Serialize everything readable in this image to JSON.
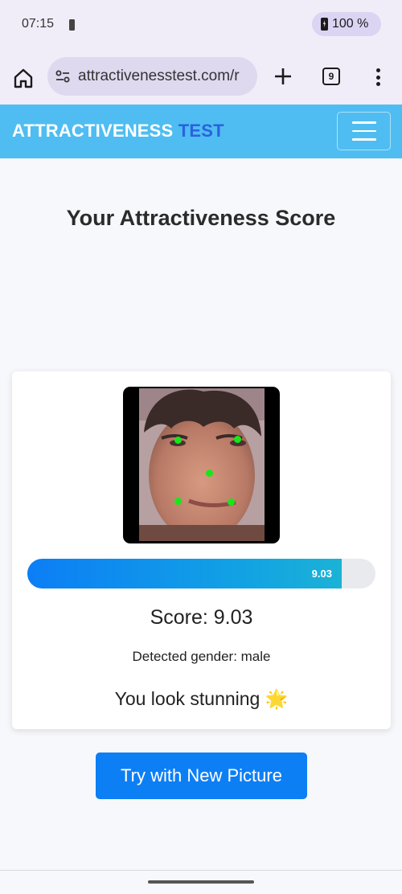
{
  "status_bar": {
    "time": "07:15",
    "battery": "100 %"
  },
  "browser": {
    "url": "attractivenesstest.com/r",
    "tab_count": "9"
  },
  "site": {
    "brand_part1": "ATTRACTIVENESS",
    "brand_part2": "TEST"
  },
  "main": {
    "title": "Your Attractiveness Score",
    "progress_value": 9.03,
    "progress_max": 10,
    "progress_label": "9.03",
    "score_text": "Score: 9.03",
    "gender_text": "Detected gender: male",
    "verdict_text": "You look stunning",
    "verdict_emoji": "🌟",
    "button_label": "Try with New Picture"
  },
  "colors": {
    "navbar": "#4fbdf1",
    "brand_accent": "#2a62e0",
    "button": "#0d7ff5",
    "landmark": "#19e619"
  },
  "icons": [
    "battery-icon",
    "home-icon",
    "site-info-icon",
    "plus-icon",
    "tab-switcher-icon",
    "more-vert-icon",
    "hamburger-icon"
  ]
}
